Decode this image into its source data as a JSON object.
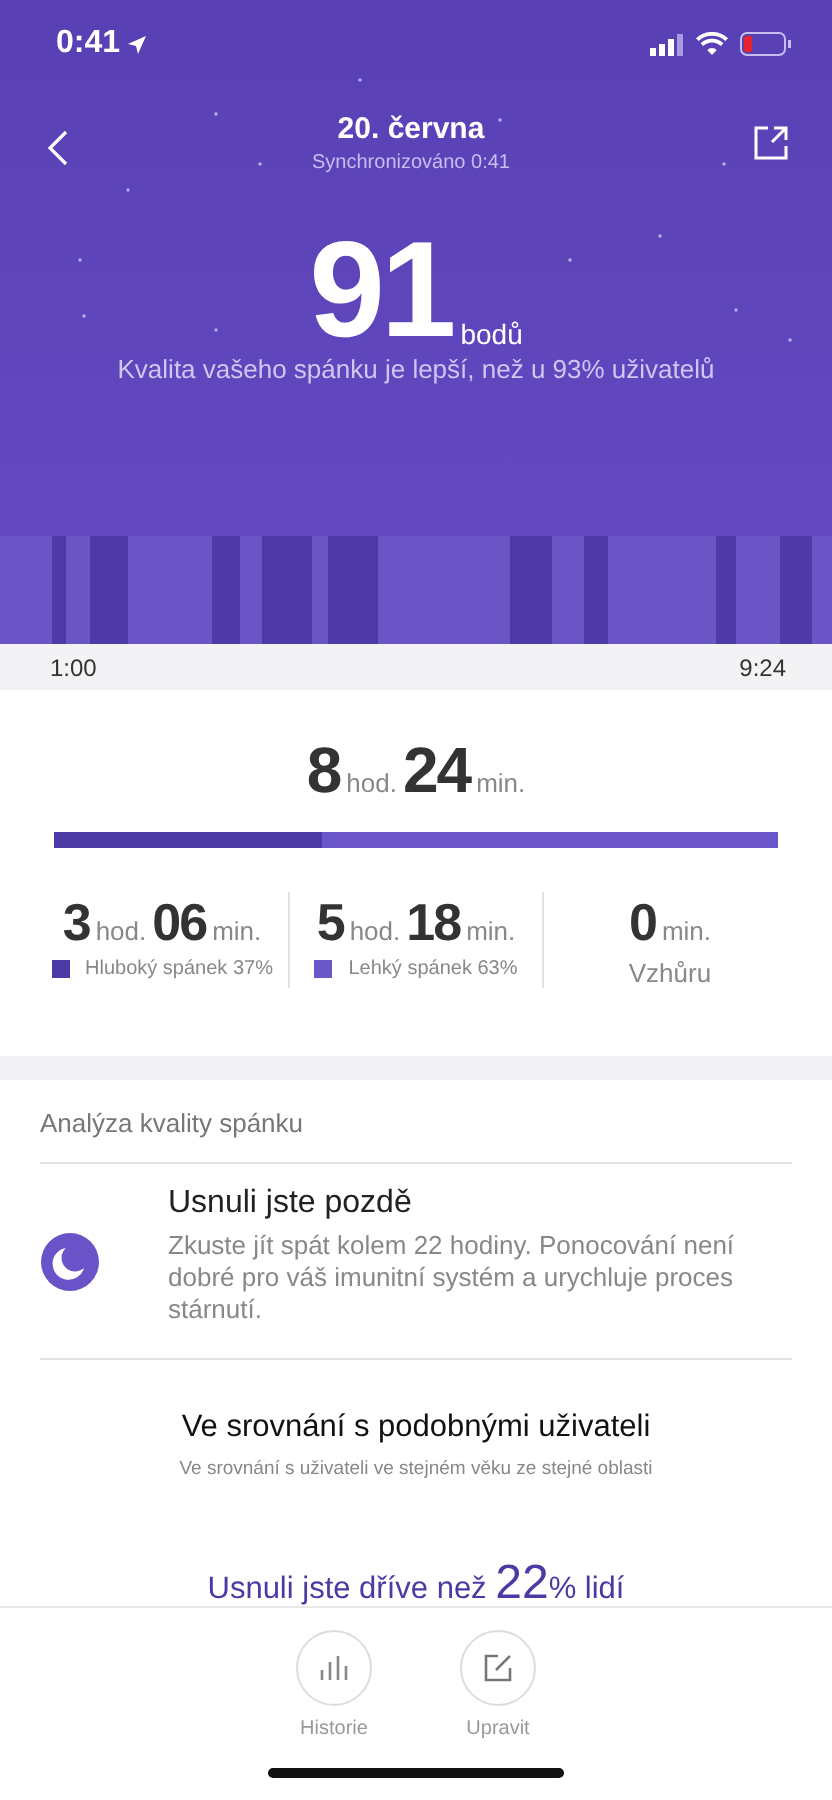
{
  "status_bar": {
    "time": "0:41"
  },
  "header": {
    "title": "20. června",
    "subtitle": "Synchronizováno 0:41"
  },
  "score": {
    "value": "91",
    "unit": "bodů",
    "comparison": "Kvalita vašeho spánku je lepší, než u 93% uživatelů"
  },
  "timeline": {
    "start": "1:00",
    "end": "9:24"
  },
  "total": {
    "hours": "8",
    "hours_unit": "hod.",
    "minutes": "24",
    "minutes_unit": "min.",
    "level": 0.37
  },
  "stages": [
    {
      "kind": "deep",
      "hours": "3",
      "hours_unit": "hod.",
      "minutes": "06",
      "minutes_unit": "min.",
      "label": "Hluboký spánek 37%",
      "color": "#4b3aa3"
    },
    {
      "kind": "light",
      "hours": "5",
      "hours_unit": "hod.",
      "minutes": "18",
      "minutes_unit": "min.",
      "label": "Lehký spánek 63%",
      "color": "#6a56c8"
    },
    {
      "kind": "awake",
      "minutes": "0",
      "minutes_unit": "min.",
      "label": "Vzhůru"
    }
  ],
  "analysis": {
    "heading": "Analýza kvality spánku",
    "items": [
      {
        "title": "Usnuli jste pozdě",
        "text": "Zkuste jít spát kolem 22 hodiny. Ponocování není dobré pro váš imunitní systém a urychluje proces stárnutí."
      }
    ]
  },
  "comparison": {
    "title": "Ve srovnání s podobnými uživateli",
    "subtitle": "Ve srovnání s uživateli ve stejném věku ze stejné oblasti",
    "result": "Usnuli jste dříve než **22**% lidí"
  },
  "actions": [
    {
      "kind": "history",
      "label": "Historie"
    },
    {
      "kind": "edit",
      "label": "Upravit"
    }
  ]
}
